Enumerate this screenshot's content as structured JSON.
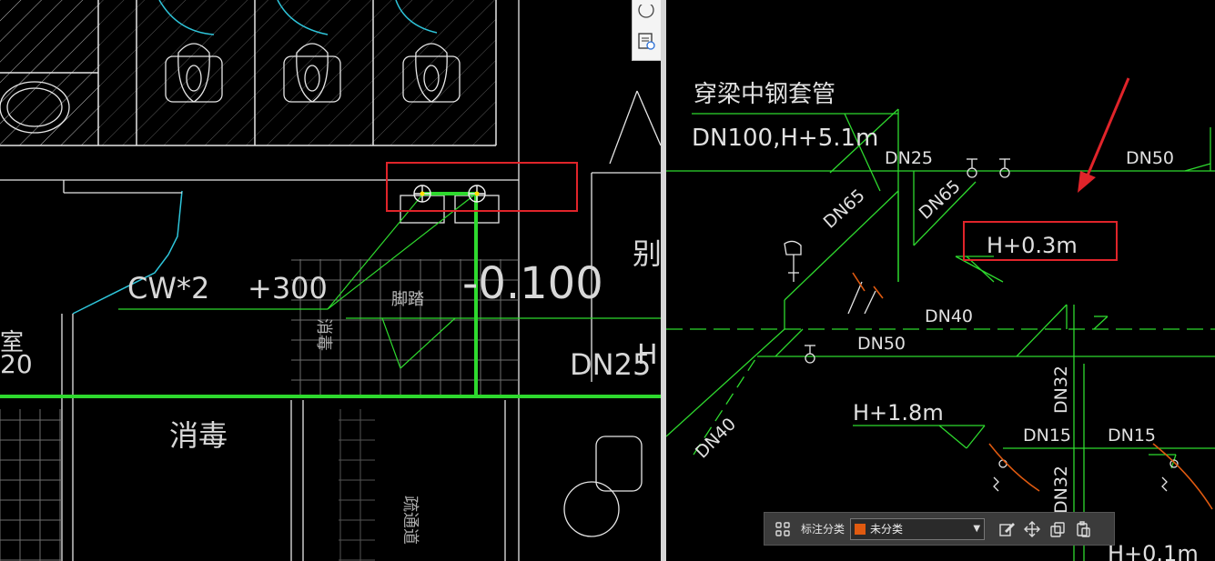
{
  "left_pane": {
    "labels": {
      "cw": "CW*2",
      "plus300": "+300",
      "elev": "-0.100",
      "dn25": "DN25",
      "xiaodu": "消毒",
      "xiaodu_vertical": "消毒",
      "jiaota": "脚踏",
      "room": "室",
      "num20": "20",
      "shudao": "疏通道",
      "partial_char": "H",
      "side_partial": "别"
    },
    "highlight_color": "#e0242a",
    "pipe_color": "#2ed92e"
  },
  "right_pane": {
    "labels": {
      "title": "穿梁中钢套管",
      "spec": "DN100,H+5.1m",
      "dn25": "DN25",
      "dn50_top": "DN50",
      "dn65_a": "DN65",
      "dn65_b": "DN65",
      "h03": "H+0.3m",
      "dn40_mid": "DN40",
      "dn50_mid": "DN50",
      "dn40_diag": "DN40",
      "h18": "H+1.8m",
      "dn15_a": "DN15",
      "dn15_b": "DN15",
      "dn32_a": "DN32",
      "dn32_b": "DN32",
      "h01": "H+0.1m"
    }
  },
  "side_toolbar": {
    "items": [
      {
        "icon": "circle-icon"
      },
      {
        "icon": "document-view-icon"
      }
    ]
  },
  "annotation_bar": {
    "category_label": "标注分类",
    "category_value": "未分类",
    "category_color": "#e05a10",
    "buttons": [
      "grid-icon",
      "edit-icon",
      "move-icon",
      "copy-icon",
      "paste-icon"
    ]
  }
}
